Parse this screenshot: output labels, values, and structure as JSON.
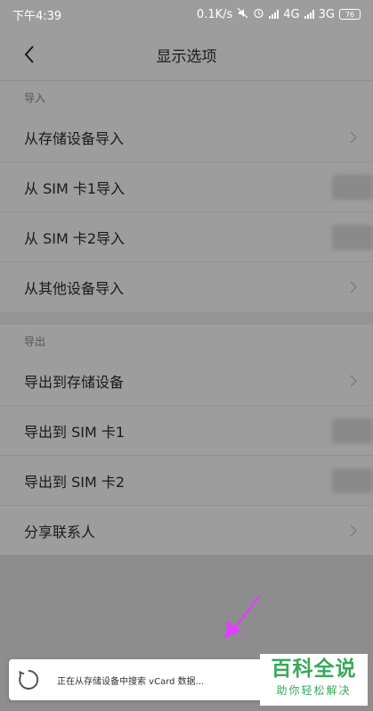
{
  "status_bar": {
    "time": "下午4:39",
    "net_speed": "0.1K/s",
    "network_4g": "4G",
    "network_3g": "3G",
    "battery": "76"
  },
  "header": {
    "title": "显示选项"
  },
  "import_section": {
    "label": "导入",
    "items": [
      {
        "label": "从存储设备导入"
      },
      {
        "label": "从 SIM 卡1导入"
      },
      {
        "label": "从 SIM 卡2导入"
      },
      {
        "label": "从其他设备导入"
      }
    ]
  },
  "export_section": {
    "label": "导出",
    "items": [
      {
        "label": "导出到存储设备"
      },
      {
        "label": "导出到 SIM 卡1"
      },
      {
        "label": "导出到 SIM 卡2"
      },
      {
        "label": "分享联系人"
      }
    ]
  },
  "toast": {
    "text": "正在从存储设备中搜索 vCard 数据..."
  },
  "watermark": {
    "main": "百科全说",
    "sub": "助你轻松解决"
  },
  "colors": {
    "arrow": "#e040fb",
    "watermark": "#3aa85b",
    "overlay": "#9d9d9d"
  }
}
